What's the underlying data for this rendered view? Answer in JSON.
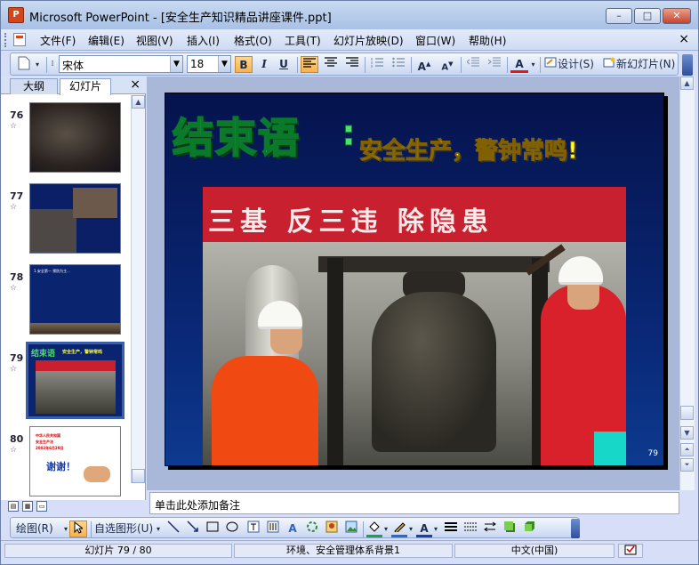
{
  "window": {
    "app_icon": "P",
    "title": "Microsoft PowerPoint - [安全生产知识精品讲座课件.ppt]",
    "minimize": "–",
    "maximize": "□",
    "close": "✕"
  },
  "menu": {
    "items": [
      "文件(F)",
      "编辑(E)",
      "视图(V)",
      "插入(I)",
      "格式(O)",
      "工具(T)",
      "幻灯片放映(D)",
      "窗口(W)",
      "帮助(H)"
    ],
    "close": "×"
  },
  "toolbar": {
    "font_name": "宋体",
    "font_size": "18",
    "bold": "B",
    "italic": "I",
    "underline": "U",
    "design_label": "设计(S)",
    "new_slide_label": "新幻灯片(N)"
  },
  "left_pane": {
    "tabs": [
      "大纲",
      "幻灯片"
    ],
    "close": "×",
    "thumbnails": [
      {
        "number": "76",
        "star": "☆"
      },
      {
        "number": "77",
        "star": "☆"
      },
      {
        "number": "78",
        "star": "☆"
      },
      {
        "number": "79",
        "star": "☆"
      },
      {
        "number": "80",
        "star": "☆"
      }
    ]
  },
  "thumb_text": {
    "t78": "1.安全第一 预防为主...",
    "t79_title": "结束语",
    "t79_sub": "安全生产，警钟常鸣",
    "t80_lines": [
      "中华人民共和国",
      "安全生产法",
      "2002年6月29日"
    ],
    "t80_big": "谢谢！"
  },
  "slide": {
    "title": "结束语",
    "colon": ":",
    "subtitle": "安全生产，警钟常鸣!",
    "banner_text": "三基  反三违  除隐患",
    "page_number": "79"
  },
  "notes": {
    "placeholder": "单击此处添加备注"
  },
  "drawing_toolbar": {
    "draw_label": "绘图(R)",
    "autoshapes_label": "自选图形(U)"
  },
  "status": {
    "slide_indicator": "幻灯片 79 / 80",
    "design_template": "环境、安全管理体系背景1",
    "language": "中文(中国)"
  },
  "colors": {
    "title_green": "#4de06b",
    "subtitle_yellow": "#ffff33",
    "slide_bg": "#0a2a7a",
    "banner_red": "#c8202f"
  }
}
